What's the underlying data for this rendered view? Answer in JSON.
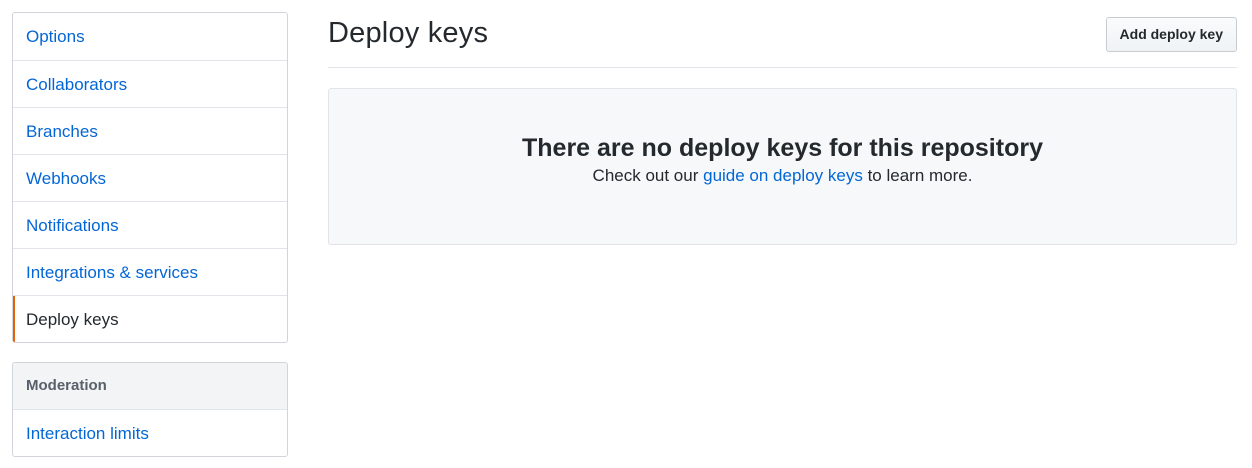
{
  "sidebar": {
    "settings_items": [
      {
        "label": "Options"
      },
      {
        "label": "Collaborators"
      },
      {
        "label": "Branches"
      },
      {
        "label": "Webhooks"
      },
      {
        "label": "Notifications"
      },
      {
        "label": "Integrations & services"
      },
      {
        "label": "Deploy keys",
        "selected": true
      }
    ],
    "moderation": {
      "heading": "Moderation",
      "items": [
        {
          "label": "Interaction limits"
        }
      ]
    }
  },
  "main": {
    "title": "Deploy keys",
    "add_button_label": "Add deploy key",
    "empty_state": {
      "title": "There are no deploy keys for this repository",
      "text_before": "Check out our ",
      "link_text": "guide on deploy keys",
      "text_after": " to learn more."
    }
  },
  "colors": {
    "link": "#0366d6",
    "selected_indicator": "#e36209",
    "text": "#24292e"
  }
}
